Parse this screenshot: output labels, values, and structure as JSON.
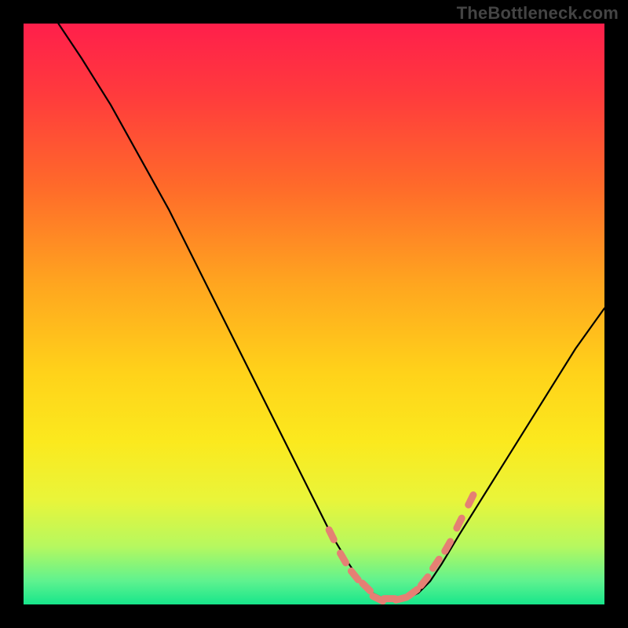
{
  "watermark": "TheBottleneck.com",
  "chart_data": {
    "type": "line",
    "title": "",
    "xlabel": "",
    "ylabel": "",
    "xlim": [
      0,
      100
    ],
    "ylim": [
      0,
      100
    ],
    "series": [
      {
        "name": "curve",
        "x": [
          6,
          10,
          15,
          20,
          25,
          30,
          35,
          40,
          45,
          50,
          53,
          56,
          58,
          60,
          62,
          64,
          66,
          68,
          70,
          72,
          75,
          80,
          85,
          90,
          95,
          100
        ],
        "y": [
          100,
          94,
          86,
          77,
          68,
          58,
          48,
          38,
          28,
          18,
          12,
          7,
          4,
          2,
          1,
          1,
          1,
          2,
          4,
          7,
          12,
          20,
          28,
          36,
          44,
          51
        ]
      }
    ],
    "markers": {
      "comment": "salmon dashed-dot markers along the low valley of the curve",
      "color": "#e58074",
      "x": [
        53,
        55,
        57,
        59,
        61,
        63,
        65,
        67,
        69,
        71,
        73,
        75,
        77
      ],
      "y": [
        12,
        8,
        5,
        3,
        1,
        1,
        1,
        2,
        4,
        7,
        10,
        14,
        18
      ]
    },
    "background_gradient": {
      "direction": "top-to-bottom",
      "stops": [
        {
          "pos": 0.0,
          "color": "#ff1f4b"
        },
        {
          "pos": 0.12,
          "color": "#ff3a3d"
        },
        {
          "pos": 0.28,
          "color": "#ff6a2a"
        },
        {
          "pos": 0.45,
          "color": "#ffa61f"
        },
        {
          "pos": 0.6,
          "color": "#ffd21a"
        },
        {
          "pos": 0.72,
          "color": "#fbe91e"
        },
        {
          "pos": 0.82,
          "color": "#e9f53a"
        },
        {
          "pos": 0.9,
          "color": "#b6f85f"
        },
        {
          "pos": 0.96,
          "color": "#5ef28f"
        },
        {
          "pos": 1.0,
          "color": "#17e68b"
        }
      ]
    }
  }
}
